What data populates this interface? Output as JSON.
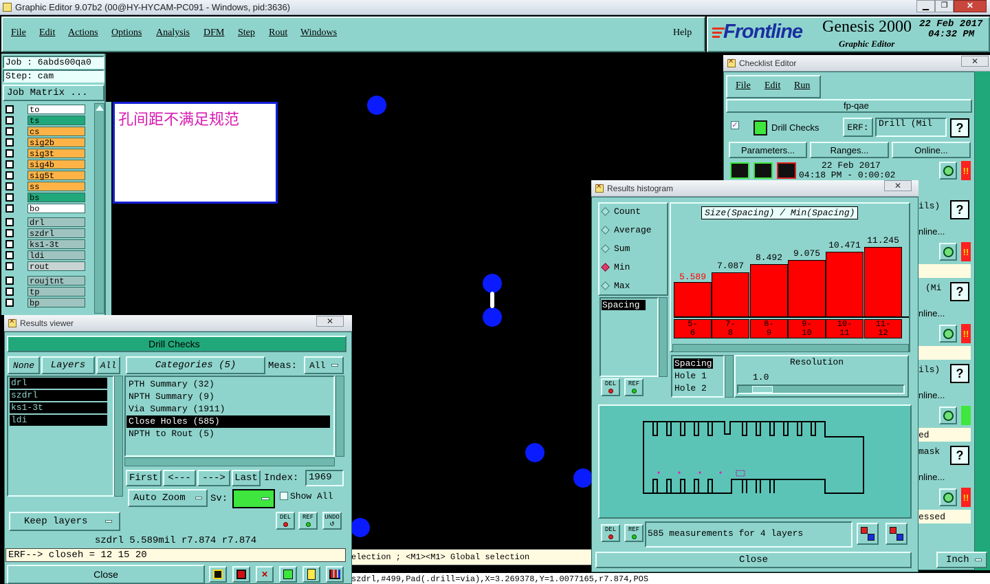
{
  "app": {
    "title": "Graphic Editor 9.07b2 (00@HY-HYCAM-PC091 - Windows, pid:3636)",
    "menu": [
      "File",
      "Edit",
      "Actions",
      "Options",
      "Analysis",
      "DFM",
      "Step",
      "Rout",
      "Windows"
    ],
    "help": "Help",
    "brand": "Frontline",
    "product": "Genesis 2000",
    "product_sub": "Graphic Editor",
    "date": "22 Feb 2017",
    "time": "04:32 PM"
  },
  "job_panel": {
    "job": "Job  : 6abds00qa0",
    "step": "Step: cam",
    "matrix_button": "Job Matrix ...",
    "layers": [
      {
        "name": "to",
        "color": "#ffffff"
      },
      {
        "name": "ts",
        "color": "#21a87a"
      },
      {
        "name": "cs",
        "color": "#ffb347"
      },
      {
        "name": "sig2b",
        "color": "#ffb347"
      },
      {
        "name": "sig3t",
        "color": "#ffb347"
      },
      {
        "name": "sig4b",
        "color": "#ffb347"
      },
      {
        "name": "sig5t",
        "color": "#ffb347"
      },
      {
        "name": "ss",
        "color": "#ffb347"
      },
      {
        "name": "bs",
        "color": "#21a87a"
      },
      {
        "name": "bo",
        "color": "#ffffff"
      }
    ],
    "drill_layers": [
      {
        "name": "drl",
        "color": "#9fc4c0"
      },
      {
        "name": "szdrl",
        "color": "#9fc4c0"
      },
      {
        "name": "ks1-3t",
        "color": "#9fc4c0"
      },
      {
        "name": "ldi",
        "color": "#9fc4c0"
      },
      {
        "name": "rout",
        "color": "#c7d4d2"
      }
    ],
    "other_layers": [
      {
        "name": "roujtnt",
        "color": "#9fc4c0"
      },
      {
        "name": "tp",
        "color": "#9fc4c0"
      },
      {
        "name": "bp",
        "color": "#9fc4c0"
      }
    ]
  },
  "note": {
    "text": "孔间距不满足规范"
  },
  "results_viewer": {
    "title": "Results viewer",
    "header": "Drill Checks",
    "none_label": "None",
    "layers_label": "Layers",
    "all_label": "All",
    "categories_label": "Categories (5)",
    "meas_label": "Meas:",
    "meas_value": "All",
    "layer_list": [
      "drl",
      "szdrl",
      "ks1-3t",
      "ldi"
    ],
    "categories": [
      "PTH Summary (32)",
      "NPTH Summary (9)",
      "Via Summary (1911)",
      "Close Holes (585)",
      "NPTH to Rout (5)"
    ],
    "selected_category": 3,
    "first": "First",
    "prev": "<---",
    "next": "--->",
    "last": "Last",
    "index_label": "Index:",
    "index_value": "1969",
    "auto_zoom": "Auto Zoom",
    "sv_label": "Sv:",
    "show_all": "Show All",
    "keep_layers": "Keep layers",
    "del": "DEL",
    "ref": "REF",
    "undo": "UNDO",
    "info_line": "szdrl 5.589mil   r7.874   r7.874",
    "erf_line": "ERF--> closeh = 12 15 20",
    "close": "Close"
  },
  "status": {
    "selection": "election ; <M1><M1> Global selection",
    "coords": "szdrl,#499,Pad(.drill=via),X=3.269378,Y=1.0077165,r7.874,POS"
  },
  "histogram": {
    "title": "Results histogram",
    "modes": [
      "Count",
      "Average",
      "Sum",
      "Min",
      "Max"
    ],
    "selected_mode": 3,
    "list_item": "Spacing",
    "chart_title": "Size(Spacing) / Min(Spacing)",
    "resolution_label": "Resolution",
    "resolution_value": "1.0",
    "fields": [
      "Spacing",
      "Hole 1",
      "Hole 2"
    ],
    "measurements": "585 measurements for 4 layers",
    "close": "Close",
    "del": "DEL",
    "ref": "REF"
  },
  "chart_data": {
    "type": "bar",
    "title": "Size(Spacing) / Min(Spacing)",
    "categories": [
      "5-6",
      "7-8",
      "8-9",
      "9-10",
      "10-11",
      "11-12"
    ],
    "category_labels_top": [
      "5-",
      "7-",
      "8-",
      "9-",
      "10-",
      "11-"
    ],
    "category_labels_bottom": [
      "6",
      "8",
      "9",
      "10",
      "11",
      "12"
    ],
    "values": [
      5.589,
      7.087,
      8.492,
      9.075,
      10.471,
      11.245
    ],
    "value_labels": [
      "5.589",
      "7.087",
      "8.492",
      "9.075",
      "10.471",
      "11.245"
    ],
    "highlight_index": 0,
    "bar_color": "#ff0000",
    "highlight_label_color": "#ff0000",
    "ylim": [
      0,
      12
    ]
  },
  "checklist": {
    "title": "Checklist Editor",
    "menu": [
      "File",
      "Edit",
      "Run"
    ],
    "name": "fp-qae",
    "check_name": "Drill Checks",
    "erf_label": "ERF:",
    "erf_value": "Drill (Mil",
    "parameters": "Parameters...",
    "ranges": "Ranges...",
    "online": "Online...",
    "run_date": "22 Feb 2017",
    "run_time": "04:18 PM - 0:00:02",
    "partial_rows": [
      "ils)",
      "nline...",
      "(Mi",
      "nline...",
      "ils)",
      "nline...",
      "ed",
      "mask",
      "nline...",
      "essed"
    ],
    "units": "Inch"
  },
  "icons": {
    "check": "check-icon",
    "zoom": "zoom-icon",
    "help": "help-icon",
    "run": "run-icon"
  }
}
